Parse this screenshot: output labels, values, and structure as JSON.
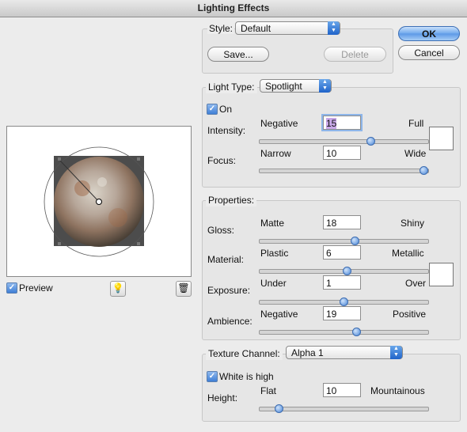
{
  "window": {
    "title": "Lighting Effects"
  },
  "style": {
    "label": "Style:",
    "value": "Default",
    "save": "Save...",
    "delete": "Delete"
  },
  "buttons": {
    "ok": "OK",
    "cancel": "Cancel"
  },
  "light": {
    "label": "Light Type:",
    "value": "Spotlight",
    "on_label": "On",
    "on": true,
    "intensity": {
      "label": "Intensity:",
      "min": "Negative",
      "max": "Full",
      "value": "15",
      "level": 0.67
    },
    "focus": {
      "label": "Focus:",
      "min": "Narrow",
      "max": "Wide",
      "value": "10",
      "level": 1.0
    },
    "swatch_color": "#ffffff"
  },
  "properties": {
    "label": "Properties:",
    "gloss": {
      "label": "Gloss:",
      "min": "Matte",
      "max": "Shiny",
      "value": "18",
      "level": 0.57
    },
    "material": {
      "label": "Material:",
      "min": "Plastic",
      "max": "Metallic",
      "value": "6",
      "level": 0.52
    },
    "exposure": {
      "label": "Exposure:",
      "min": "Under",
      "max": "Over",
      "value": "1",
      "level": 0.5
    },
    "ambience": {
      "label": "Ambience:",
      "min": "Negative",
      "max": "Positive",
      "value": "19",
      "level": 0.58
    },
    "swatch_color": "#ffffff"
  },
  "texture": {
    "label": "Texture Channel:",
    "value": "Alpha 1",
    "white_is_high_label": "White is high",
    "white_is_high": true,
    "height": {
      "label": "Height:",
      "min": "Flat",
      "max": "Mountainous",
      "value": "10",
      "level": 0.1
    }
  },
  "preview": {
    "label": "Preview",
    "checked": true,
    "bulb_icon": "light-bulb-icon",
    "trash_icon": "trash-icon"
  },
  "colors": {
    "accent": "#3f7fd6",
    "dialog_bg": "#ececec"
  }
}
